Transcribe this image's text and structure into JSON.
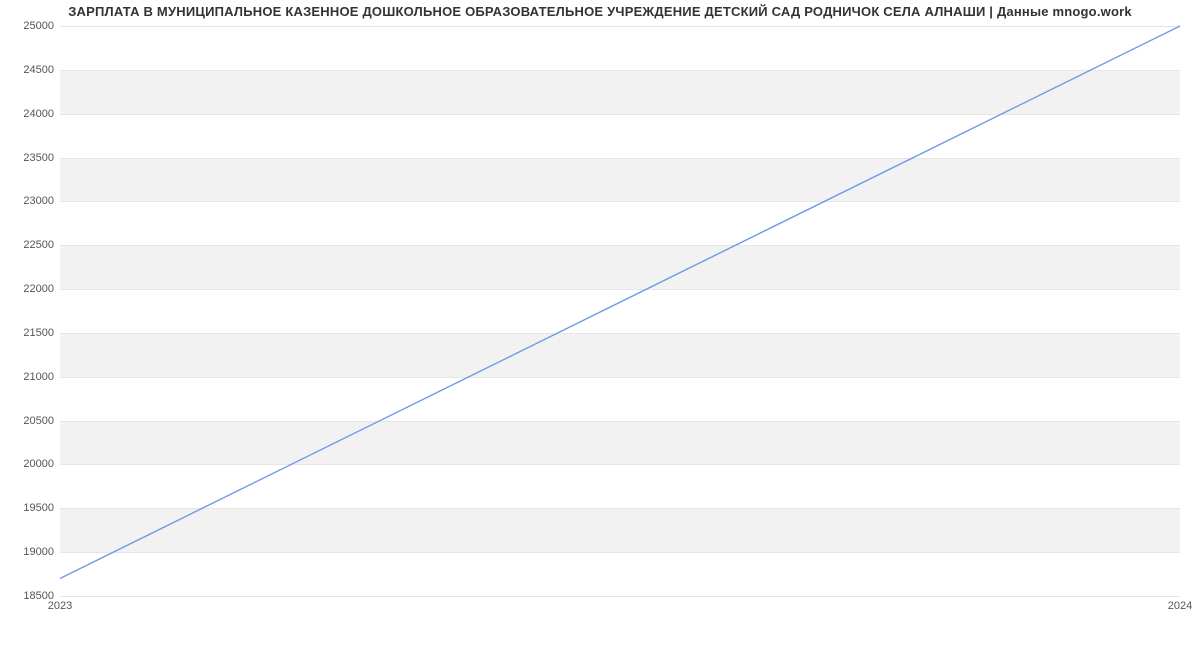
{
  "chart_data": {
    "type": "line",
    "title": "ЗАРПЛАТА В МУНИЦИПАЛЬНОЕ КАЗЕННОЕ ДОШКОЛЬНОЕ ОБРАЗОВАТЕЛЬНОЕ УЧРЕЖДЕНИЕ ДЕТСКИЙ САД РОДНИЧОК СЕЛА АЛНАШИ | Данные mnogo.work",
    "x": [
      2023,
      2024
    ],
    "x_ticks": [
      "2023",
      "2024"
    ],
    "series": [
      {
        "name": "salary",
        "values": [
          18700,
          25000
        ]
      }
    ],
    "xlabel": "",
    "ylabel": "",
    "ylim": [
      18500,
      25000
    ],
    "y_ticks": [
      18500,
      19000,
      19500,
      20000,
      20500,
      21000,
      21500,
      22000,
      22500,
      23000,
      23500,
      24000,
      24500,
      25000
    ],
    "grid": true,
    "line_color": "#6f9ae8",
    "band_color": "#f2f2f2"
  }
}
